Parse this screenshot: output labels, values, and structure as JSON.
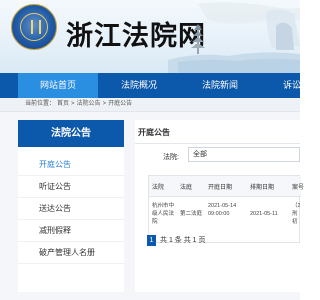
{
  "header": {
    "site_title": "浙江法院网"
  },
  "nav": {
    "items": [
      {
        "label": "网站首页",
        "active": true
      },
      {
        "label": "法院概况",
        "active": false
      },
      {
        "label": "法院新闻",
        "active": false
      },
      {
        "label": "诉讼",
        "active": false
      }
    ]
  },
  "breadcrumb": {
    "prefix": "当前位置：",
    "items": [
      "首页",
      "法院公告",
      "开庭公告"
    ],
    "separator": ">"
  },
  "sidebar": {
    "title": "法院公告",
    "items": [
      {
        "label": "开庭公告",
        "active": true
      },
      {
        "label": "听证公告",
        "active": false
      },
      {
        "label": "送达公告",
        "active": false
      },
      {
        "label": "减刑假释",
        "active": false
      },
      {
        "label": "破产管理人名册",
        "active": false
      }
    ]
  },
  "main": {
    "title": "开庭公告",
    "filter": {
      "label": "法院:",
      "value": "全部"
    },
    "table": {
      "headers": [
        "法院",
        "法庭",
        "开庭日期",
        "排期日期",
        "案号"
      ],
      "rows": [
        {
          "court": "杭州市中级人民法院",
          "tribunal": "第二法庭",
          "hearing_date": "2021-05-14 09:00:00",
          "schedule_date": "2021-05-11",
          "case_no": "（2 刑初"
        }
      ]
    },
    "pager": {
      "current": "1",
      "info": "共 1 条 共 1 页"
    }
  },
  "colors": {
    "nav_bg": "#0c58aa",
    "nav_active": "#2a8fe0",
    "sidebar_active": "#2a7fd0"
  }
}
